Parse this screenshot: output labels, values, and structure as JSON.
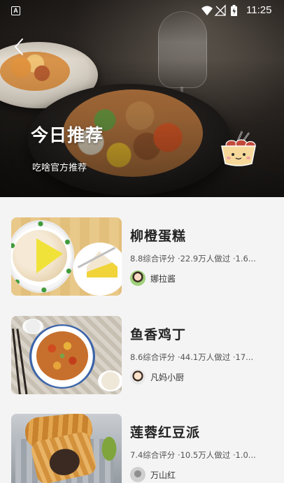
{
  "status_bar": {
    "notification_letter": "A",
    "time": "11:25",
    "icons": [
      "wifi-icon",
      "cellular-icon",
      "battery-charging-icon"
    ]
  },
  "header": {
    "back_icon": "chevron-left-icon",
    "title": "今日推荐",
    "subtitle": "吃啥官方推荐",
    "mascot_icon": "takoyaki-mascot-icon"
  },
  "recipes": [
    {
      "title": "柳橙蛋糕",
      "meta": "8.8综合评分 ·22.9万人做过 ·1.6...",
      "author": "娜拉酱",
      "thumb_icon": "orange-cake-image"
    },
    {
      "title": "鱼香鸡丁",
      "meta": "8.6综合评分 ·44.1万人做过 ·17...",
      "author": "凡妈小厨",
      "thumb_icon": "yuxiang-chicken-image"
    },
    {
      "title": "莲蓉红豆派",
      "meta": "7.4综合评分 ·10.5万人做过 ·1.0...",
      "author": "万山红",
      "thumb_icon": "lotus-redbean-pie-image"
    }
  ],
  "colors": {
    "page_background": "#f4f4f4",
    "title_text": "#222222",
    "meta_text": "#555555",
    "hero_text": "#ffffff"
  }
}
